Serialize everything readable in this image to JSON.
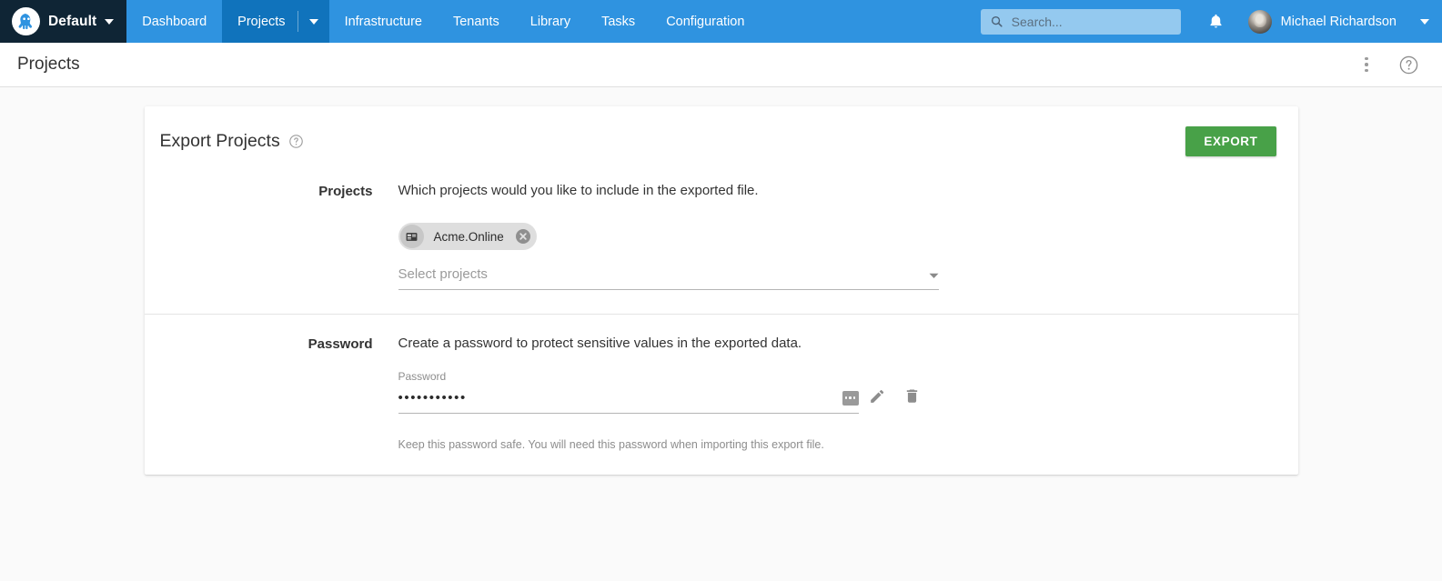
{
  "topnav": {
    "brand": {
      "label": "Default",
      "logo_icon": "octopus-logo-icon",
      "caret_icon": "caret-down-icon"
    },
    "links": [
      {
        "label": "Dashboard",
        "active": false
      },
      {
        "label": "Projects",
        "active": true
      },
      {
        "label": "Infrastructure",
        "active": false
      },
      {
        "label": "Tenants",
        "active": false
      },
      {
        "label": "Library",
        "active": false
      },
      {
        "label": "Tasks",
        "active": false
      },
      {
        "label": "Configuration",
        "active": false
      }
    ],
    "search": {
      "placeholder": "Search...",
      "value": "",
      "icon": "search-icon"
    },
    "notifications_icon": "bell-icon",
    "user": {
      "name": "Michael Richardson",
      "avatar_icon": "user-avatar",
      "caret_icon": "caret-down-icon"
    },
    "colors": {
      "bar": "#2f93e0",
      "active_tab": "#1073bc",
      "brand_bg": "#0f2535",
      "search_bg": "#94c9ef"
    }
  },
  "pagehead": {
    "title": "Projects",
    "overflow_icon": "kebab-menu-icon",
    "help_icon": "help-circle-icon"
  },
  "card": {
    "title": "Export Projects",
    "title_help_icon": "help-circle-icon",
    "export_button": "EXPORT",
    "export_button_color": "#48a148",
    "rows": [
      {
        "label": "Projects",
        "description": "Which projects would you like to include in the exported file.",
        "chips": [
          {
            "label": "Acme.Online",
            "avatar_icon": "project-card-icon",
            "remove_icon": "close-circle-icon"
          }
        ],
        "select": {
          "placeholder": "Select projects",
          "value": "",
          "caret_icon": "caret-down-icon"
        }
      },
      {
        "label": "Password",
        "description": "Create a password to protect sensitive values in the exported data.",
        "field_label": "Password",
        "field_value": "•••••••••••",
        "toggle_icon": "show-password-icon",
        "edit_icon": "pencil-icon",
        "delete_icon": "trash-icon",
        "hint": "Keep this password safe. You will need this password when importing this export file."
      }
    ]
  }
}
